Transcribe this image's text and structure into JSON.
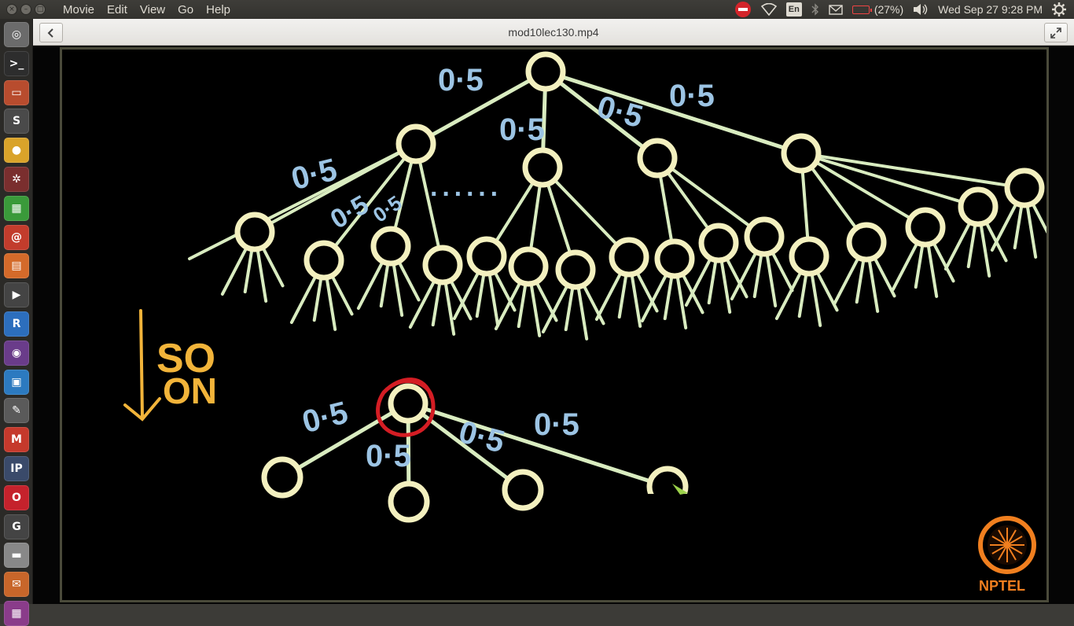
{
  "top_panel": {
    "menu": [
      "Movie",
      "Edit",
      "View",
      "Go",
      "Help"
    ],
    "keyboard_layout": "En",
    "battery_text": "(27%)",
    "battery_level": 0.27,
    "datetime": "Wed Sep 27  9:28 PM"
  },
  "header_bar": {
    "title": "mod10lec130.mp4"
  },
  "launcher": {
    "items": [
      {
        "name": "dash-home",
        "glyph": "◎",
        "color": "#6b6b6b"
      },
      {
        "name": "terminal",
        "glyph": ">_",
        "color": "#2d2d2d"
      },
      {
        "name": "file-manager",
        "glyph": "▭",
        "color": "#b84c2e"
      },
      {
        "name": "sublime-text",
        "glyph": "S",
        "color": "#4a4a4a"
      },
      {
        "name": "chrome",
        "glyph": "●",
        "color": "#d9a32a"
      },
      {
        "name": "settings",
        "glyph": "✲",
        "color": "#7a2e2e"
      },
      {
        "name": "spreadsheet",
        "glyph": "▦",
        "color": "#3a9a3a"
      },
      {
        "name": "email-client",
        "glyph": "@",
        "color": "#c23c2c"
      },
      {
        "name": "presentation",
        "glyph": "▤",
        "color": "#d46a2a"
      },
      {
        "name": "video-player",
        "glyph": "▶",
        "color": "#444"
      },
      {
        "name": "r-language",
        "glyph": "R",
        "color": "#2c6ebd"
      },
      {
        "name": "media-app",
        "glyph": "◉",
        "color": "#6a3c8a"
      },
      {
        "name": "document-viewer",
        "glyph": "▣",
        "color": "#2c7ac0"
      },
      {
        "name": "text-editor",
        "glyph": "✎",
        "color": "#5a5a5a"
      },
      {
        "name": "gmail",
        "glyph": "M",
        "color": "#c5392c"
      },
      {
        "name": "ipython",
        "glyph": "IP",
        "color": "#3a4a6a"
      },
      {
        "name": "opera",
        "glyph": "O",
        "color": "#c5222c"
      },
      {
        "name": "gp-tool",
        "glyph": "G",
        "color": "#444"
      },
      {
        "name": "drive-icon",
        "glyph": "▬",
        "color": "#888"
      },
      {
        "name": "installer",
        "glyph": "✉",
        "color": "#c8662a"
      },
      {
        "name": "app-bottom",
        "glyph": "▦",
        "color": "#8a3c8a"
      }
    ]
  },
  "video": {
    "edge_labels_top": [
      "0·5",
      "0·5",
      "0·5",
      "0·5",
      "0·5",
      "0·5",
      "0·5"
    ],
    "ellipsis": "······",
    "arrow_text": [
      "SO",
      "ON"
    ],
    "edge_labels_bottom": [
      "0·5",
      "0·5",
      "0·5",
      "0·5"
    ],
    "logo_text": "NPTEL",
    "colors": {
      "node": "#f3f0bf",
      "edge": "#d9ecc0",
      "label": "#9cc4e4",
      "arrow": "#f2b43a",
      "highlight": "#d41d24",
      "logo": "#f07f1f"
    }
  }
}
